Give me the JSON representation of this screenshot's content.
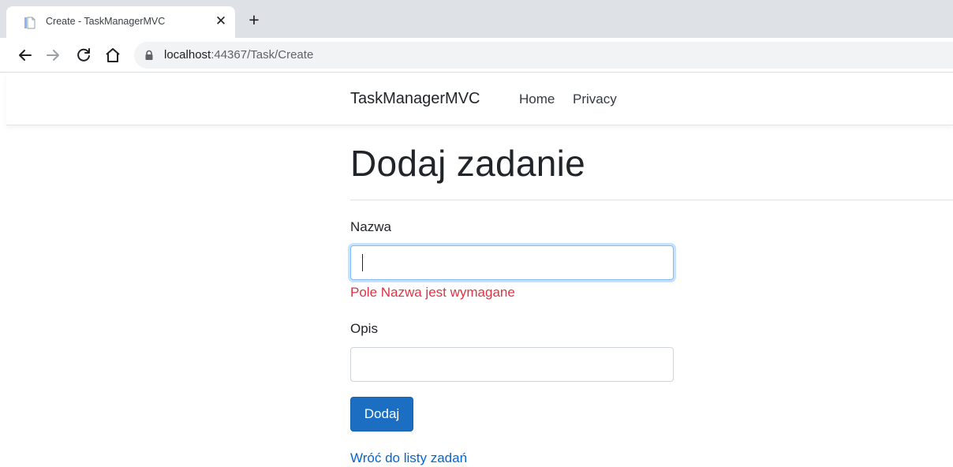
{
  "browser": {
    "tab_title": "Create - TaskManagerMVC",
    "tab_close": "✕",
    "new_tab": "+",
    "url_host": "localhost",
    "url_path": ":44367/Task/Create"
  },
  "navbar": {
    "brand": "TaskManagerMVC",
    "links": [
      "Home",
      "Privacy"
    ]
  },
  "page": {
    "title": "Dodaj zadanie"
  },
  "form": {
    "name_label": "Nazwa",
    "name_value": "",
    "name_error": "Pole Nazwa jest wymagane",
    "desc_label": "Opis",
    "desc_value": "",
    "submit_label": "Dodaj"
  },
  "back_link": "Wróć do listy zadań",
  "colors": {
    "error": "#dc3545",
    "primary_button": "#1b6ec2",
    "link": "#0366d6",
    "focus_border": "#80bdff"
  },
  "icons": {
    "tab": "document-favicon-icon",
    "back": "arrow-left-icon",
    "forward": "arrow-right-icon",
    "reload": "reload-icon",
    "home": "home-icon",
    "lock": "lock-icon"
  }
}
